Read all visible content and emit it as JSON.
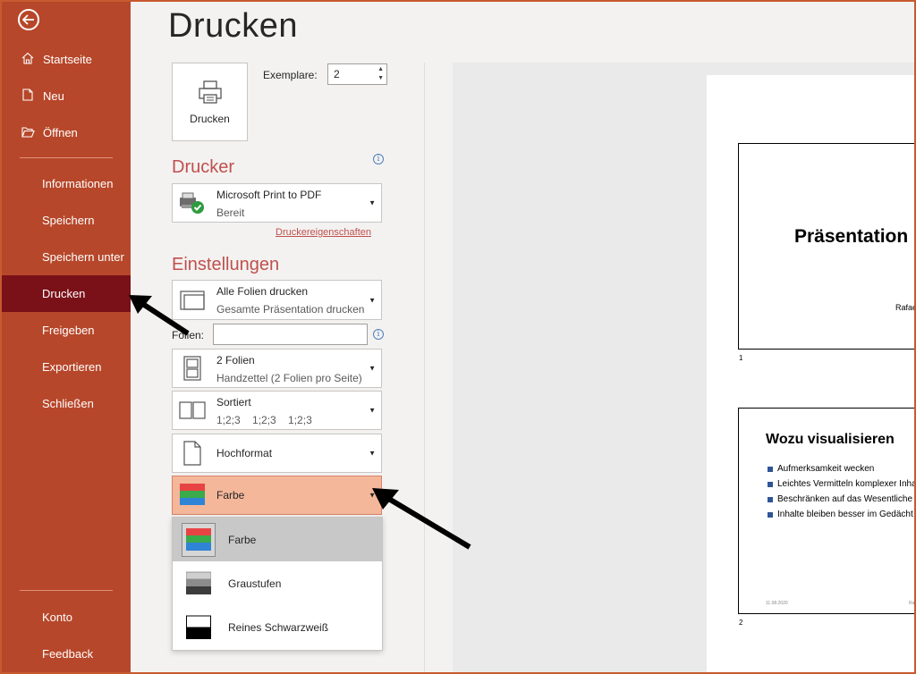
{
  "sidebar": {
    "back_icon": "back-arrow-icon",
    "top_items": [
      {
        "label": "Startseite",
        "icon": "home-icon"
      },
      {
        "label": "Neu",
        "icon": "new-file-icon"
      },
      {
        "label": "Öffnen",
        "icon": "folder-open-icon"
      }
    ],
    "mid_items": [
      {
        "label": "Informationen"
      },
      {
        "label": "Speichern"
      },
      {
        "label": "Speichern unter"
      },
      {
        "label": "Drucken",
        "active": true
      },
      {
        "label": "Freigeben"
      },
      {
        "label": "Exportieren"
      },
      {
        "label": "Schließen"
      }
    ],
    "bottom_items": [
      {
        "label": "Konto"
      },
      {
        "label": "Feedback"
      }
    ],
    "colors": {
      "bg": "#b7472a",
      "active": "#7a1018"
    }
  },
  "main": {
    "title": "Drucken",
    "print_button_label": "Drucken",
    "copies_label": "Exemplare:",
    "copies_value": "2",
    "printer_heading": "Drucker",
    "printer": {
      "name": "Microsoft Print to PDF",
      "status": "Bereit"
    },
    "printer_properties_link": "Druckereigenschaften",
    "settings_heading": "Einstellungen",
    "slides_range": {
      "line1": "Alle Folien drucken",
      "line2": "Gesamte Präsentation drucken"
    },
    "folien_label": "Folien:",
    "folien_value": "",
    "layout": {
      "line1": "2 Folien",
      "line2": "Handzettel (2 Folien pro Seite)"
    },
    "collate": {
      "line1": "Sortiert",
      "line2": "1;2;3    1;2;3    1;2;3"
    },
    "orientation": "Hochformat",
    "color_mode": "Farbe",
    "color_options": [
      "Farbe",
      "Graustufen",
      "Reines Schwarzweiß"
    ],
    "accent_color": "#c0504d"
  },
  "preview": {
    "slide1": {
      "title": "Präsentation",
      "subtitle": "Rafae",
      "number": "1"
    },
    "slide2": {
      "title": "Wozu visualisieren",
      "bullets": [
        "Aufmerksamkeit wecken",
        "Leichtes Vermitteln komplexer Inha",
        "Beschränken auf das Wesentliche",
        "Inhalte bleiben besser im Gedächt"
      ],
      "footer_date": "11.08.2020",
      "footer_right": "Ra",
      "number": "2"
    }
  }
}
